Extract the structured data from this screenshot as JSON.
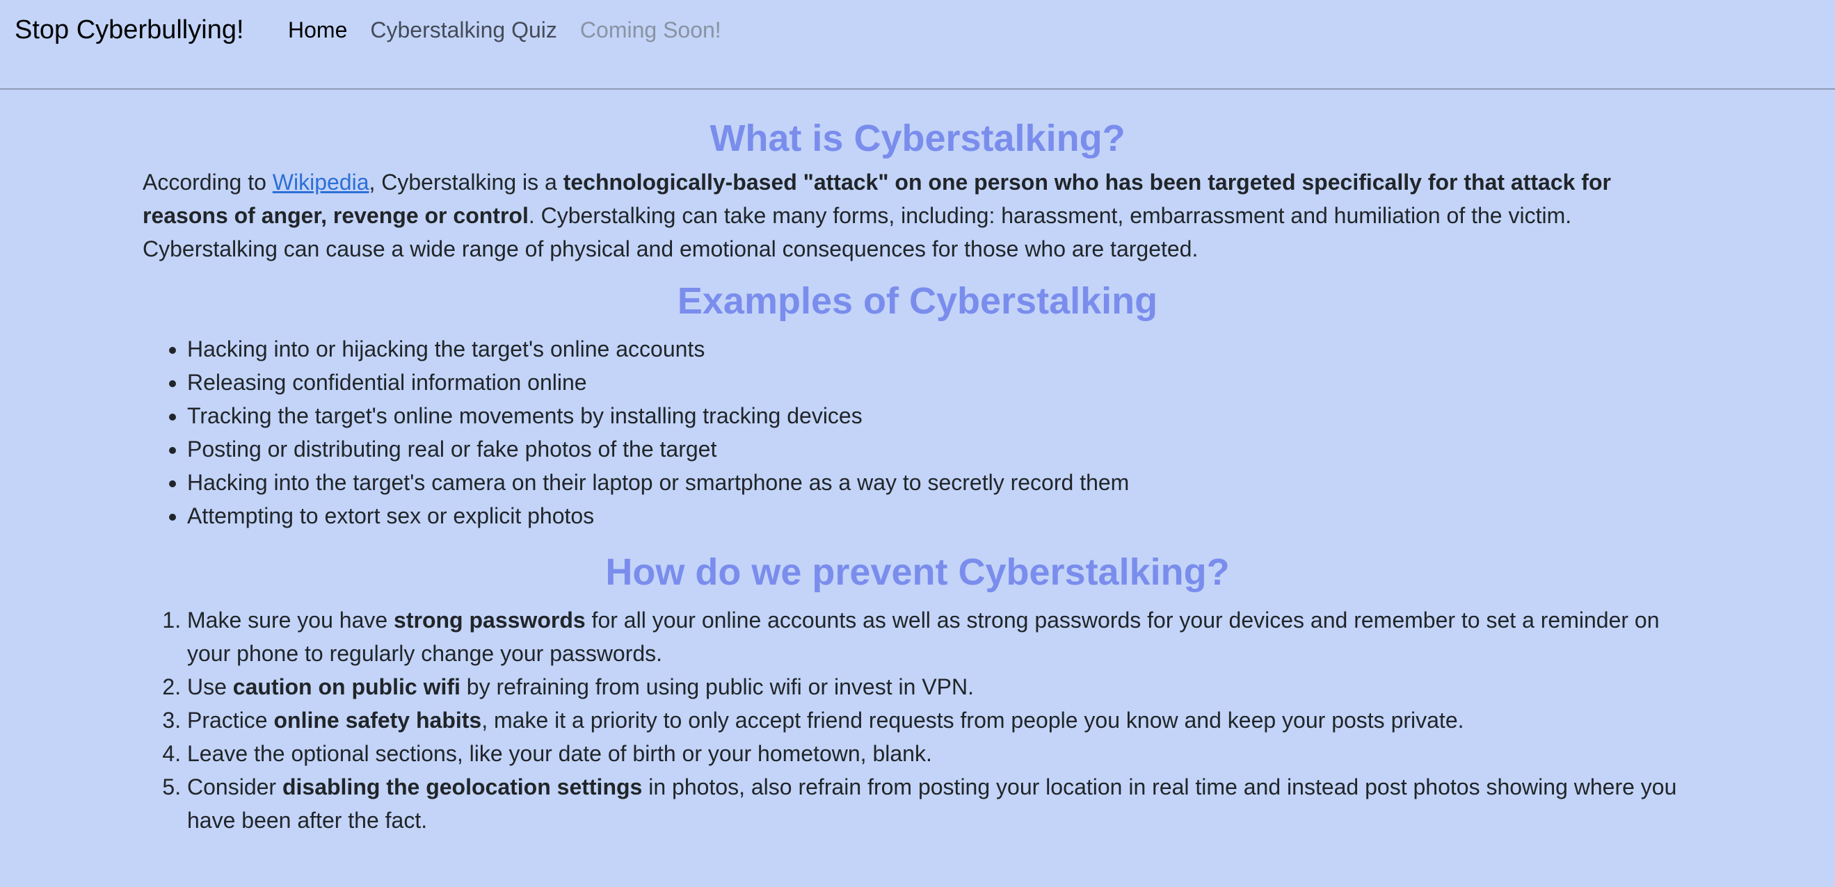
{
  "navbar": {
    "brand": "Stop Cyberbullying!",
    "links": [
      {
        "label": "Home"
      },
      {
        "label": "Cyberstalking Quiz"
      },
      {
        "label": "Coming Soon!"
      }
    ]
  },
  "section1": {
    "title": "What is Cyberstalking?",
    "p_before_link": "According to ",
    "link_text": "Wikipedia",
    "p_after_link": ", Cyberstalking is a ",
    "p_bold": "technologically-based \"attack\" on one person who has been targeted specifically for that attack for reasons of anger, revenge or control",
    "p_rest": ". Cyberstalking can take many forms, including: harassment, embarrassment and humiliation of the victim. Cyberstalking can cause a wide range of physical and emotional consequences for those who are targeted."
  },
  "section2": {
    "title": "Examples of Cyberstalking",
    "items": [
      "Hacking into or hijacking the target's online accounts",
      "Releasing confidential information online",
      "Tracking the target's online movements by installing tracking devices",
      "Posting or distributing real or fake photos of the target",
      "Hacking into the target's camera on their laptop or smartphone as a way to secretly record them",
      "Attempting to extort sex or explicit photos"
    ]
  },
  "section3": {
    "title": "How do we prevent Cyberstalking?",
    "items": [
      {
        "pre": "Make sure you have ",
        "bold": "strong passwords",
        "post": " for all your online accounts as well as strong passwords for your devices and remember to set a reminder on your phone to regularly change your passwords."
      },
      {
        "pre": "Use ",
        "bold": "caution on public wifi",
        "post": " by refraining from using public wifi or invest in VPN."
      },
      {
        "pre": "Practice ",
        "bold": "online safety habits",
        "post": ", make it a priority to only accept friend requests from people you know and keep your posts private."
      },
      {
        "pre": "Leave the optional sections, like your date of birth or your hometown, blank.",
        "bold": "",
        "post": ""
      },
      {
        "pre": "Consider ",
        "bold": "disabling the geolocation settings",
        "post": " in photos, also refrain from posting your location in real time and instead post photos showing where you have been after the fact."
      }
    ]
  }
}
